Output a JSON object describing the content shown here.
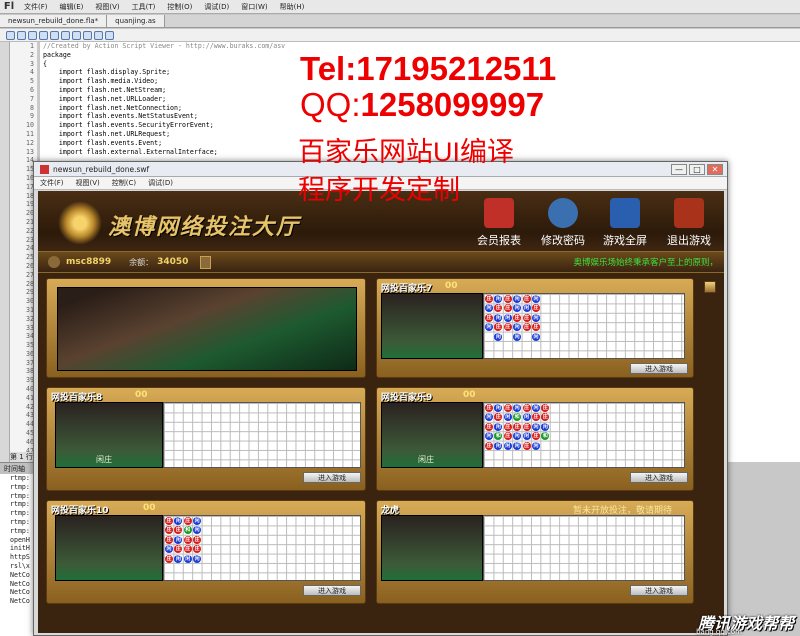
{
  "ide": {
    "logo": "Fl",
    "menu": [
      "文件(F)",
      "编辑(E)",
      "视图(V)",
      "工具(T)",
      "控制(O)",
      "调试(D)",
      "窗口(W)",
      "帮助(H)"
    ],
    "tabs": [
      "newsun_rebuild_done.fla*",
      "quanjing.as"
    ],
    "line_numbers": [
      "1",
      "2",
      "3",
      "4",
      "5",
      "6",
      "7",
      "8",
      "9",
      "10",
      "11",
      "12",
      "13",
      "14",
      "15",
      "16",
      "17",
      "18",
      "19",
      "20",
      "21",
      "22",
      "23",
      "24",
      "25",
      "26",
      "27",
      "28",
      "29",
      "30",
      "31",
      "32",
      "33",
      "34",
      "35",
      "36",
      "37",
      "38",
      "39",
      "40",
      "41",
      "42",
      "43",
      "44",
      "45",
      "46",
      "47"
    ],
    "code_lines": [
      "//Created by Action Script Viewer - http://www.buraks.com/asv",
      "package",
      "{",
      "    import flash.display.Sprite;",
      "    import flash.media.Video;",
      "    import flash.net.NetStream;",
      "    import flash.net.URLLoader;",
      "    import flash.net.NetConnection;",
      "    import flash.events.NetStatusEvent;",
      "    import flash.events.SecurityErrorEvent;",
      "    import flash.net.URLRequest;",
      "    import flash.events.Event;",
      "    import flash.external.ExternalInterface;"
    ],
    "status_line": "第 1 行",
    "timeline_label": "时间轴",
    "lower_list": [
      "rtmp:",
      "rtmp:",
      "rtmp:",
      "rtmp:",
      "rtmp:",
      "rtmp:",
      "rtmp:",
      "openH",
      "initH",
      "httpS",
      "rsl\\x",
      "NetCo",
      "NetCo",
      "NetCo",
      "NetCo"
    ]
  },
  "overlay": {
    "tel": "Tel:17195212511",
    "qq_label": "QQ:",
    "qq_number": "1258099997",
    "line1": "百家乐网站UI编译",
    "line2": "程序开发定制"
  },
  "swf": {
    "title": "newsun_rebuild_done.swf",
    "menu": [
      "文件(F)",
      "视图(V)",
      "控制(C)",
      "调试(D)"
    ],
    "win_min": "—",
    "win_max": "□",
    "win_close": "✕"
  },
  "game": {
    "logo_text": "澳博网络投注大厅",
    "nav": [
      {
        "label": "会员报表",
        "icon": "calendar-report-icon",
        "color": "#c03028"
      },
      {
        "label": "修改密码",
        "icon": "key-lock-icon",
        "color": "#3a6fb0"
      },
      {
        "label": "游戏全屏",
        "icon": "monitor-icon",
        "color": "#2a5fb0"
      },
      {
        "label": "退出游戏",
        "icon": "exit-door-icon",
        "color": "#a8321a"
      }
    ],
    "user": {
      "name": "msc8899",
      "balance_label": "余额：",
      "balance": "34050"
    },
    "marquee": "奥博娱乐场始终秉承客户至上的原则，",
    "enter_label": "进入游戏",
    "tables": [
      {
        "title": "网投百家乐7",
        "count": "00"
      },
      {
        "title": "网投百家乐8",
        "count": "00"
      },
      {
        "title": "网投百家乐9",
        "count": "00"
      },
      {
        "title": "网投百家乐10",
        "count": "00"
      },
      {
        "title": "龙虎",
        "count": "",
        "closed_msg": "暂未开放投注，敬请期待"
      }
    ],
    "bead_text": {
      "r": "庄",
      "b": "闲",
      "g": "和"
    },
    "dealer_sign": "闲庄"
  },
  "watermark": {
    "brand": "腾讯游戏帮帮",
    "url": "bang.qq.com"
  }
}
